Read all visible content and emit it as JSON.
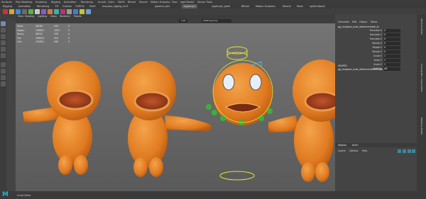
{
  "menubar": {
    "items": [
      "Surfaces",
      "Poly Modeling",
      "Sculpting",
      "Rigging",
      "Animation",
      "Rendering",
      "Arnold",
      "Cloth",
      "MASH",
      "Bifrost",
      "Muscle",
      "Motion Graphics",
      "Toon",
      "xgenToolkit",
      "Sensor Tools"
    ]
  },
  "shelf_tabs": {
    "items": [
      "Rigging",
      "Animation",
      "Rendering",
      "FX",
      "Custom",
      "TURTLE",
      "Shelf",
      "mayaaa_rigging_mcZ",
      "pipeline_dev",
      "rigsetup2",
      "rigsetup2_pmN",
      "Bifrost",
      "Motion Graphics",
      "Muscle",
      "Mash",
      "ngSkinTools2"
    ],
    "active_index": 9
  },
  "viewport": {
    "menu": [
      "View",
      "Shading",
      "Lighting",
      "Show",
      "Renderer",
      "Panels"
    ],
    "zoom_value": "1.00",
    "camera_colorspace": "sRGB gamma",
    "hud": {
      "rows": [
        {
          "label": "Verts:",
          "a": "98160",
          "b": "526",
          "c": "0"
        },
        {
          "label": "Edges:",
          "a": "196661",
          "b": "1002",
          "c": "0"
        },
        {
          "label": "Faces:",
          "a": "98520",
          "b": "476",
          "c": "0"
        },
        {
          "label": "Tris:",
          "a": "196624",
          "b": "952",
          "c": "0"
        },
        {
          "label": "UVs:",
          "a": "105601",
          "b": "596",
          "c": "0"
        }
      ]
    }
  },
  "channel_box": {
    "tabs": [
      "Channels",
      "Edit",
      "Object",
      "Show"
    ],
    "object_name": "gg_dudgeon_mod_deformerteeth_bl",
    "attributes": [
      {
        "name": "Translate X",
        "value": "0"
      },
      {
        "name": "Translate Y",
        "value": "0"
      },
      {
        "name": "Translate Z",
        "value": "0"
      },
      {
        "name": "Rotate X",
        "value": "0"
      },
      {
        "name": "Rotate Y",
        "value": "0"
      },
      {
        "name": "Rotate Z",
        "value": "0"
      },
      {
        "name": "Scale X",
        "value": "1"
      },
      {
        "name": "Scale Y",
        "value": "1"
      },
      {
        "name": "Scale Z",
        "value": "1"
      },
      {
        "name": "Visibility",
        "value": "off"
      }
    ],
    "shapes_header": "SHAPES",
    "shape_name": "gg_dudgeon_mod_deformerteethShape_CGO",
    "layer_tabs": [
      "Display",
      "Anim"
    ],
    "layer_menu": [
      "Layers",
      "Options",
      "Help"
    ]
  },
  "side_strip": {
    "labels": [
      "Attribute Editor",
      "Channel Box / Layer Editor",
      "Modeling Toolkit"
    ]
  },
  "bottom": {
    "script_label": "Script Editor",
    "logo": "M"
  },
  "colors": {
    "accent": "#4fb0ff",
    "character": "#e88a2e",
    "teeth": "#3ab23a",
    "maya_logo": "#1fb5d6"
  }
}
